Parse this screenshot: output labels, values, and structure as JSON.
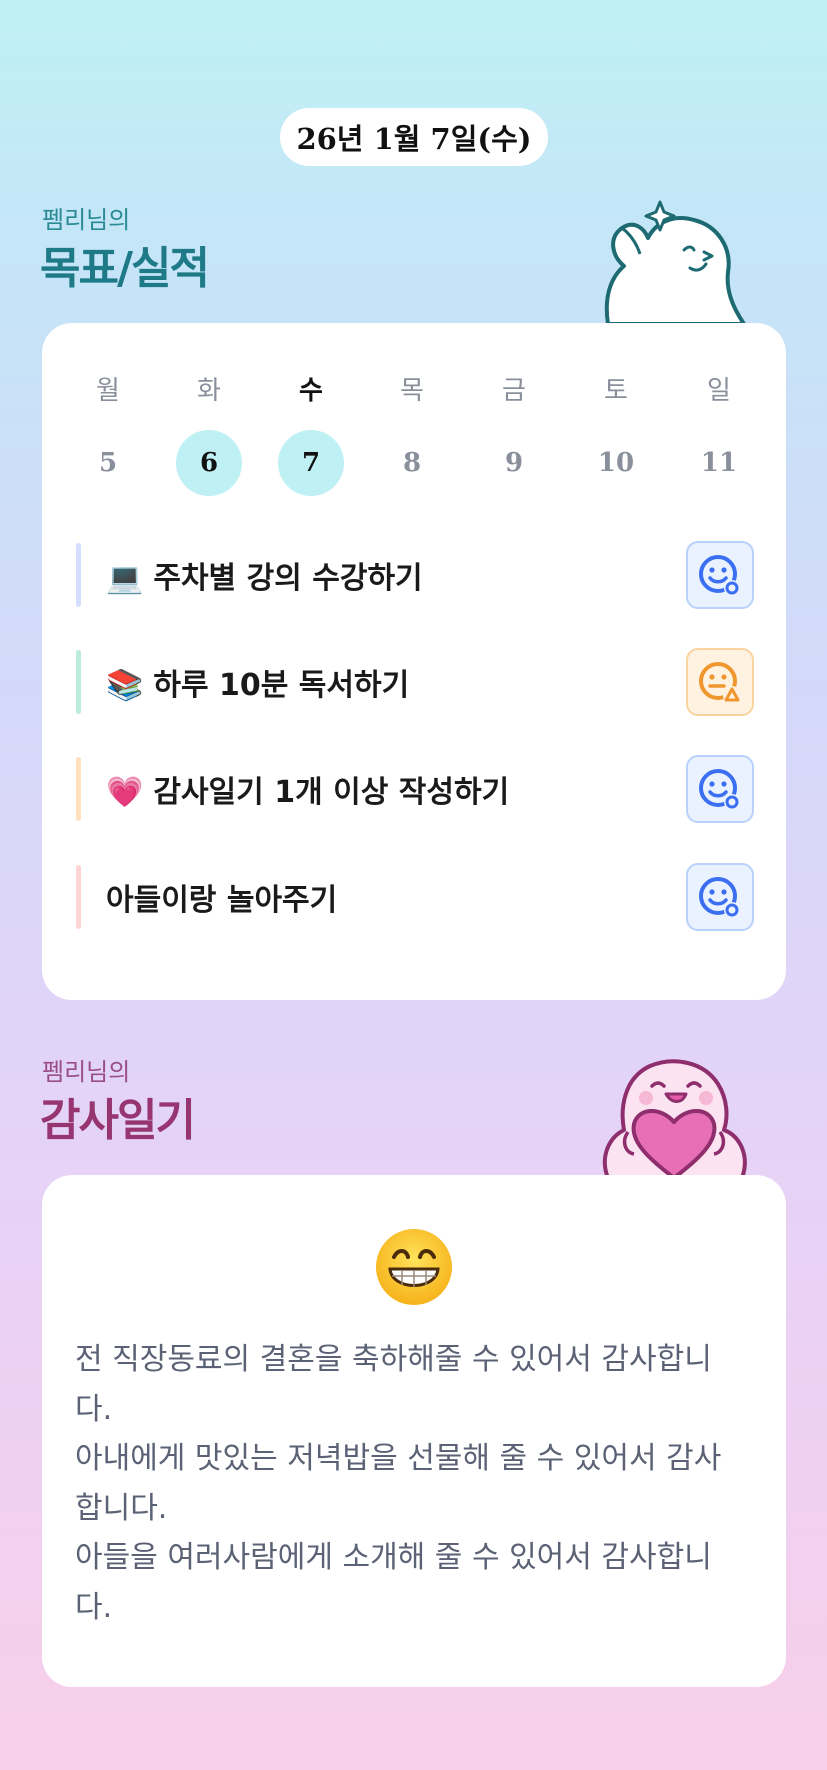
{
  "header": {
    "date": "26년 1월 7일(수)"
  },
  "goals_section": {
    "subtitle": "펨리님의",
    "title": "목표/실적",
    "week": {
      "days": [
        "월",
        "화",
        "수",
        "목",
        "금",
        "토",
        "일"
      ],
      "dates": [
        "5",
        "6",
        "7",
        "8",
        "9",
        "10",
        "11"
      ],
      "highlighted_dates": [
        "6",
        "7"
      ],
      "today": "7"
    },
    "goals": [
      {
        "emoji": "💻",
        "text": "주차별 강의 수강하기",
        "bar_color": "#d4deff",
        "status": "achieved",
        "status_icon": "smile-circle-icon"
      },
      {
        "emoji": "📚",
        "text": "하루 10분 독서하기",
        "bar_color": "#bdebdc",
        "status": "partial",
        "status_icon": "neutral-triangle-icon"
      },
      {
        "emoji": "💗",
        "text": "감사일기 1개 이상 작성하기",
        "bar_color": "#ffe1bf",
        "status": "achieved",
        "status_icon": "smile-circle-icon"
      },
      {
        "emoji": "",
        "text": "아들이랑 놀아주기",
        "bar_color": "#ffd4d4",
        "status": "achieved",
        "status_icon": "smile-circle-icon"
      }
    ]
  },
  "gratitude_section": {
    "subtitle": "펨리님의",
    "title": "감사일기",
    "mood_icon": "grinning-face-icon",
    "lines": [
      "전 직장동료의 결혼을 축하해줄 수 있어서 감사합니",
      "다.",
      "아내에게 맛있는 저녁밥을 선물해 줄 수 있어서 감사",
      "합니다.",
      "아들을 여러사람에게 소개해 줄 수 있어서 감사합니",
      "다."
    ]
  },
  "colors": {
    "achieved": "#3b6ef0",
    "partial": "#f0962e",
    "highlight": "#bff0f4",
    "goal_title": "#1e7a86",
    "diary_title": "#96356f"
  }
}
